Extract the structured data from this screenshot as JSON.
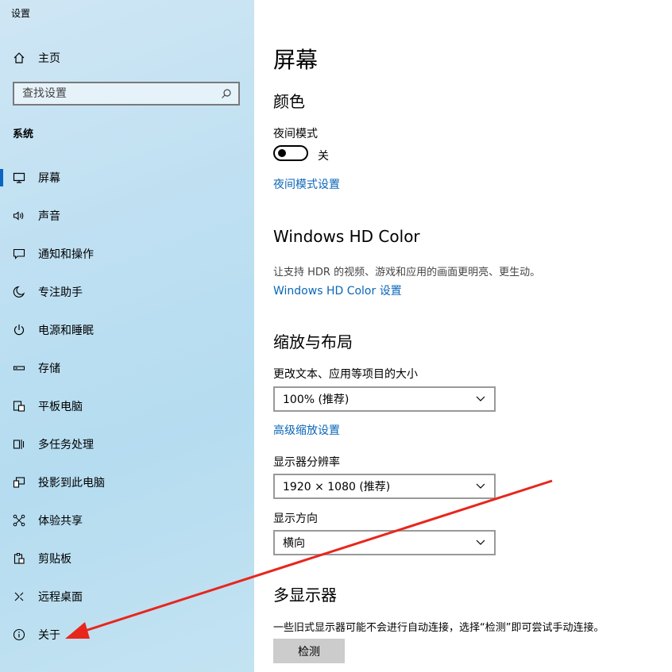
{
  "app": {
    "title": "设置"
  },
  "sidebar": {
    "home_label": "主页",
    "search_placeholder": "查找设置",
    "section": "系统",
    "items": [
      {
        "label": "屏幕",
        "icon": "monitor-icon",
        "active": true
      },
      {
        "label": "声音",
        "icon": "speaker-icon"
      },
      {
        "label": "通知和操作",
        "icon": "notification-icon"
      },
      {
        "label": "专注助手",
        "icon": "moon-icon"
      },
      {
        "label": "电源和睡眠",
        "icon": "power-icon"
      },
      {
        "label": "存储",
        "icon": "storage-icon"
      },
      {
        "label": "平板电脑",
        "icon": "tablet-icon"
      },
      {
        "label": "多任务处理",
        "icon": "multitask-icon"
      },
      {
        "label": "投影到此电脑",
        "icon": "projection-icon"
      },
      {
        "label": "体验共享",
        "icon": "share-icon"
      },
      {
        "label": "剪贴板",
        "icon": "clipboard-icon"
      },
      {
        "label": "远程桌面",
        "icon": "remote-icon"
      },
      {
        "label": "关于",
        "icon": "info-icon"
      }
    ]
  },
  "main": {
    "title": "屏幕",
    "color": {
      "heading": "颜色",
      "night_mode_label": "夜间模式",
      "night_mode_state": "关",
      "night_mode_link": "夜间模式设置"
    },
    "hdr": {
      "heading": "Windows HD Color",
      "description": "让支持 HDR 的视频、游戏和应用的画面更明亮、更生动。",
      "link": "Windows HD Color 设置"
    },
    "scale": {
      "heading": "缩放与布局",
      "size_label": "更改文本、应用等项目的大小",
      "size_value": "100% (推荐)",
      "advanced_link": "高级缩放设置",
      "resolution_label": "显示器分辨率",
      "resolution_value": "1920 × 1080 (推荐)",
      "orientation_label": "显示方向",
      "orientation_value": "横向"
    },
    "multi": {
      "heading": "多显示器",
      "description": "一些旧式显示器可能不会进行自动连接，选择“检测”即可尝试手动连接。",
      "detect_button": "检测"
    }
  },
  "annotation": {
    "arrow_color": "#e8261c"
  },
  "colors": {
    "accent": "#0a66c2",
    "link": "#0a66b8"
  }
}
